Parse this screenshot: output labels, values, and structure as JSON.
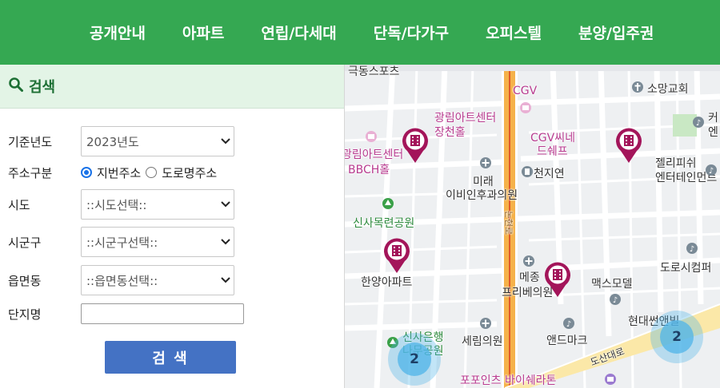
{
  "nav": {
    "items": [
      "공개안내",
      "아파트",
      "연립/다세대",
      "단독/다가구",
      "오피스텔",
      "분양/입주권"
    ]
  },
  "search": {
    "title": "검색",
    "year_label": "기준년도",
    "year_value": "2023년도",
    "address_type_label": "주소구분",
    "address_options": [
      "지번주소",
      "도로명주소"
    ],
    "address_selected": "지번주소",
    "sido_label": "시도",
    "sido_value": "::시도선택::",
    "sigungu_label": "시군구",
    "sigungu_value": "::시군구선택::",
    "eupmyeondong_label": "읍면동",
    "eupmyeondong_value": "::읍면동선택::",
    "complex_label": "단지명",
    "complex_value": "",
    "button_label": "검 색"
  },
  "map": {
    "labels": {
      "sports": "극동스포츠",
      "somang": "소망교회",
      "cgv": "CGV",
      "gwangrim_center": "광림아트센터",
      "jangcheon": "장천홀",
      "cgv_chef": "CGV씨네",
      "chef": "드쉐프",
      "gwangrim_center2": "광림아트센터",
      "bbch": "BBCH홀",
      "mirae": "미래",
      "cheonjiyeon": "천지연",
      "ibiin": "이비인후과의원",
      "jellyfish": "젤리피쉬",
      "entertainment": "엔터테인먼트",
      "ke": "커",
      "en": "엔",
      "sinsa_park": "신사목련공원",
      "dosi": "도로시컴퍼",
      "hanyang": "한양아파트",
      "mejong": "메종",
      "freebe": "프리베의원",
      "max": "맥스모델",
      "sinsa_bank": "신사은행",
      "nabi_park": "나무공원",
      "serim": "세림의원",
      "andeu": "앤드마크",
      "hyundai": "현대썬앤빌",
      "dosan": "도산대로",
      "popoints": "포포인츠 바이쉐라톤",
      "road_v": "논현로"
    },
    "clusters": [
      {
        "count": "2"
      },
      {
        "count": "2"
      }
    ]
  },
  "colors": {
    "nav_bg": "#35a852",
    "search_header_bg": "#e3f4e6",
    "button_bg": "#4472c4",
    "marker": "#a3155a",
    "cluster": "#4fb4e8",
    "main_road": "#f5b24a"
  }
}
